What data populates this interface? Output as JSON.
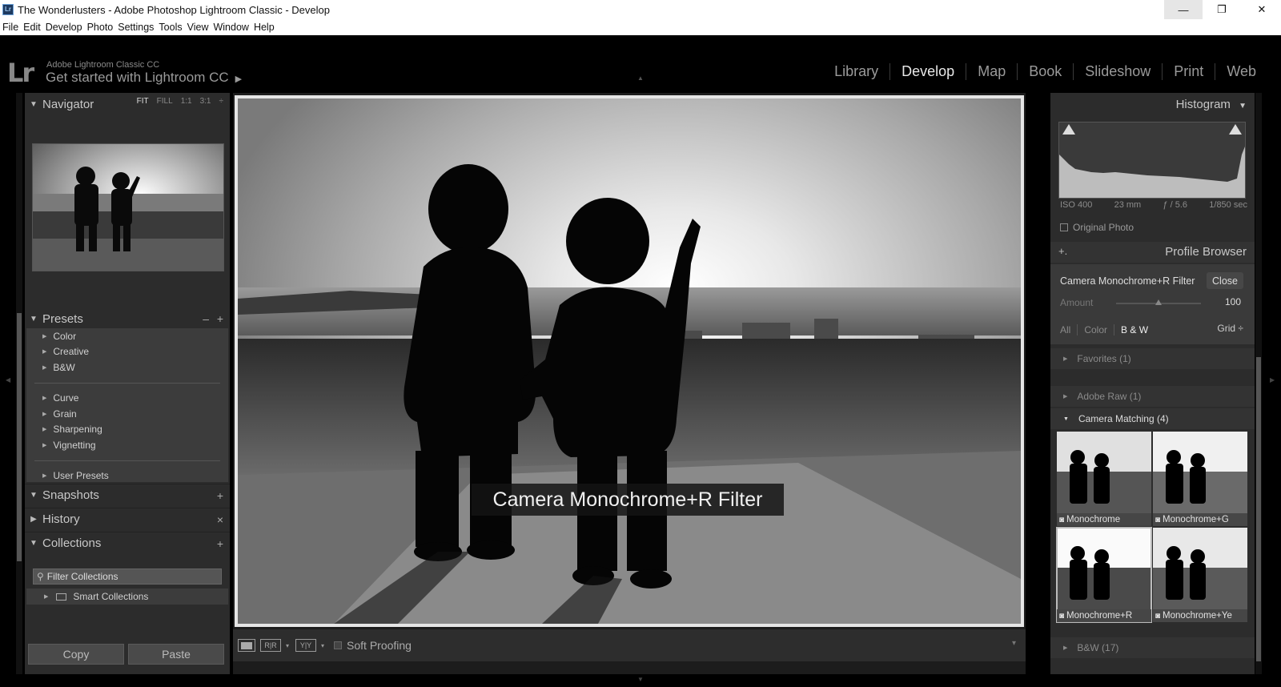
{
  "window": {
    "title": "The Wonderlusters - Adobe Photoshop Lightroom Classic - Develop",
    "app_icon": "Lr",
    "minimize": "—",
    "restore": "❐",
    "close": "✕"
  },
  "menu": [
    "File",
    "Edit",
    "Develop",
    "Photo",
    "Settings",
    "Tools",
    "View",
    "Window",
    "Help"
  ],
  "identity": {
    "logo": "Lr",
    "product": "Adobe Lightroom Classic CC",
    "cta": "Get started with Lightroom CC",
    "cta_arrow": "▶"
  },
  "modules": {
    "items": [
      "Library",
      "Develop",
      "Map",
      "Book",
      "Slideshow",
      "Print",
      "Web"
    ],
    "active": "Develop"
  },
  "left": {
    "navigator": {
      "title": "Navigator",
      "zoom": [
        "FIT",
        "FILL",
        "1:1",
        "3:1"
      ],
      "zoom_more": "÷"
    },
    "presets": {
      "title": "Presets",
      "minus": "–",
      "plus": "+",
      "group1": [
        "Color",
        "Creative",
        "B&W"
      ],
      "group2": [
        "Curve",
        "Grain",
        "Sharpening",
        "Vignetting"
      ],
      "group3": [
        "User Presets"
      ]
    },
    "snapshots": {
      "title": "Snapshots",
      "action": "+"
    },
    "history": {
      "title": "History",
      "action": "×"
    },
    "collections": {
      "title": "Collections",
      "action": "+",
      "filter": "Filter Collections",
      "smart": "Smart Collections"
    },
    "copy": "Copy",
    "paste": "Paste"
  },
  "center": {
    "profile_overlay": "Camera Monochrome+R Filter",
    "toolbar": {
      "ba_label": "R|R",
      "yy_label": "Y|Y",
      "soft_proofing": "Soft Proofing",
      "menu": "▾"
    }
  },
  "right": {
    "histogram": {
      "title": "Histogram",
      "iso": "ISO 400",
      "focal": "23 mm",
      "aperture": "ƒ / 5.6",
      "shutter": "1/850 sec",
      "original": "Original Photo"
    },
    "profile_browser": {
      "title": "Profile Browser",
      "plus": "+.",
      "current": "Camera Monochrome+R Filter",
      "close": "Close",
      "amount_label": "Amount",
      "amount": 100,
      "amount_text": "100",
      "filters": [
        "All",
        "Color",
        "B & W"
      ],
      "selected_filter": "B & W",
      "view": "Grid ÷",
      "groups": {
        "favorites": "Favorites (1)",
        "adobe_raw": "Adobe Raw (1)",
        "camera_matching": "Camera Matching (4)",
        "bw": "B&W (17)"
      },
      "thumbs": [
        "Monochrome",
        "Monochrome+G",
        "Monochrome+R",
        "Monochrome+Ye"
      ],
      "selected_thumb": "Monochrome+R"
    }
  },
  "colors": {
    "panel": "#2c2c2c",
    "accent": "#e8e8e8",
    "muted": "#9a9a9a"
  }
}
